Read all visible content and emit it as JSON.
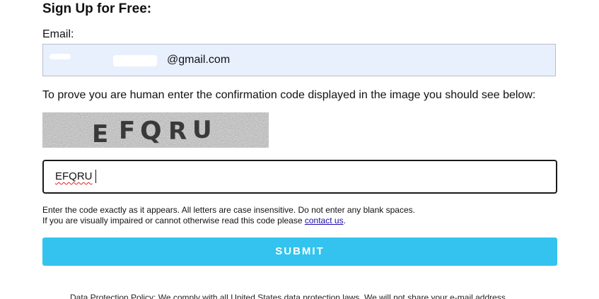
{
  "form": {
    "title": "Sign Up for Free:",
    "email_label": "Email:",
    "email_value_visible": "@gmail.com",
    "prompt": "To prove you are human enter the confirmation code displayed in the image you should see below:",
    "captcha_text": "EFQRU",
    "code_value": "EFQRU",
    "help_line_1": "Enter the code exactly as it appears. All letters are case insensitive. Do not enter any blank spaces.",
    "help_line_2": "If you are visually impaired or cannot otherwise read this code please",
    "contact_link": "contact us",
    "help_line_2_end": ".",
    "submit_label": "SUBMIT"
  },
  "footer": {
    "text": "Data Protection Policy: We comply with all United States data protection laws. We will not share your e-mail address"
  },
  "colors": {
    "email_fill": "#e8f0fe",
    "submit": "#33c3ee",
    "link": "#1a0dab"
  }
}
